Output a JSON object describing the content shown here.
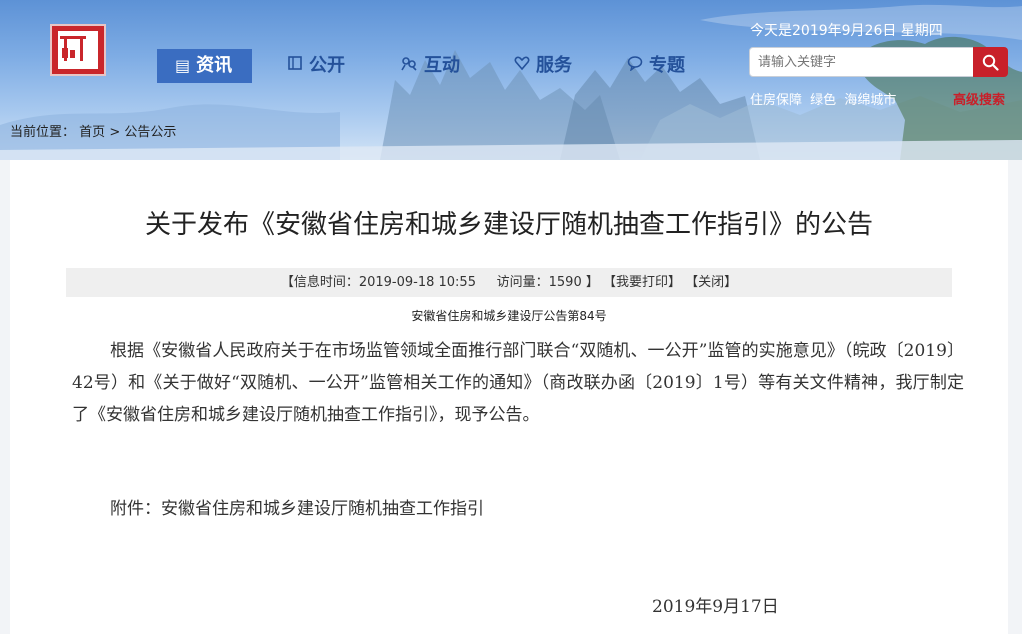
{
  "header": {
    "date_text": "今天是2019年9月26日  星期四",
    "nav": [
      {
        "label": "资讯",
        "icon": "document-list-icon",
        "active": true
      },
      {
        "label": "公开",
        "icon": "book-icon",
        "active": false
      },
      {
        "label": "互动",
        "icon": "interaction-icon",
        "active": false
      },
      {
        "label": "服务",
        "icon": "heart-icon",
        "active": false
      },
      {
        "label": "专题",
        "icon": "speech-bubble-icon",
        "active": false
      }
    ],
    "search": {
      "placeholder": "请输入关键字",
      "button_icon": "search-icon"
    },
    "quick_links": [
      "住房保障",
      "绿色",
      "海绵城市"
    ],
    "advanced_search": "高级搜索"
  },
  "breadcrumb": {
    "prefix": "当前位置：",
    "home": "首页",
    "separator": ">",
    "current": "公告公示"
  },
  "article": {
    "title": "关于发布《安徽省住房和城乡建设厅随机抽查工作指引》的公告",
    "info_time": "【信息时间：2019-09-18 10:55",
    "info_views": "访问量：1590 】",
    "print_label": "【我要打印】",
    "close_label": "【关闭】",
    "doc_number": "安徽省住房和城乡建设厅公告第84号",
    "body": "根据《安徽省人民政府关于在市场监管领域全面推行部门联合“双随机、一公开”监管的实施意见》（皖政〔2019〕42号）和《关于做好“双随机、一公开”监管相关工作的通知》（商改联办函〔2019〕1号）等有关文件精神，我厅制定了《安徽省住房和城乡建设厅随机抽查工作指引》，现予公告。",
    "attachment": "附件：安徽省住房和城乡建设厅随机抽查工作指引",
    "date": "2019年9月17日"
  },
  "colors": {
    "nav_active_bg": "#3a6dc1",
    "nav_text": "#24519a",
    "accent_red": "#c8202a",
    "logo_red": "#c9262b"
  }
}
